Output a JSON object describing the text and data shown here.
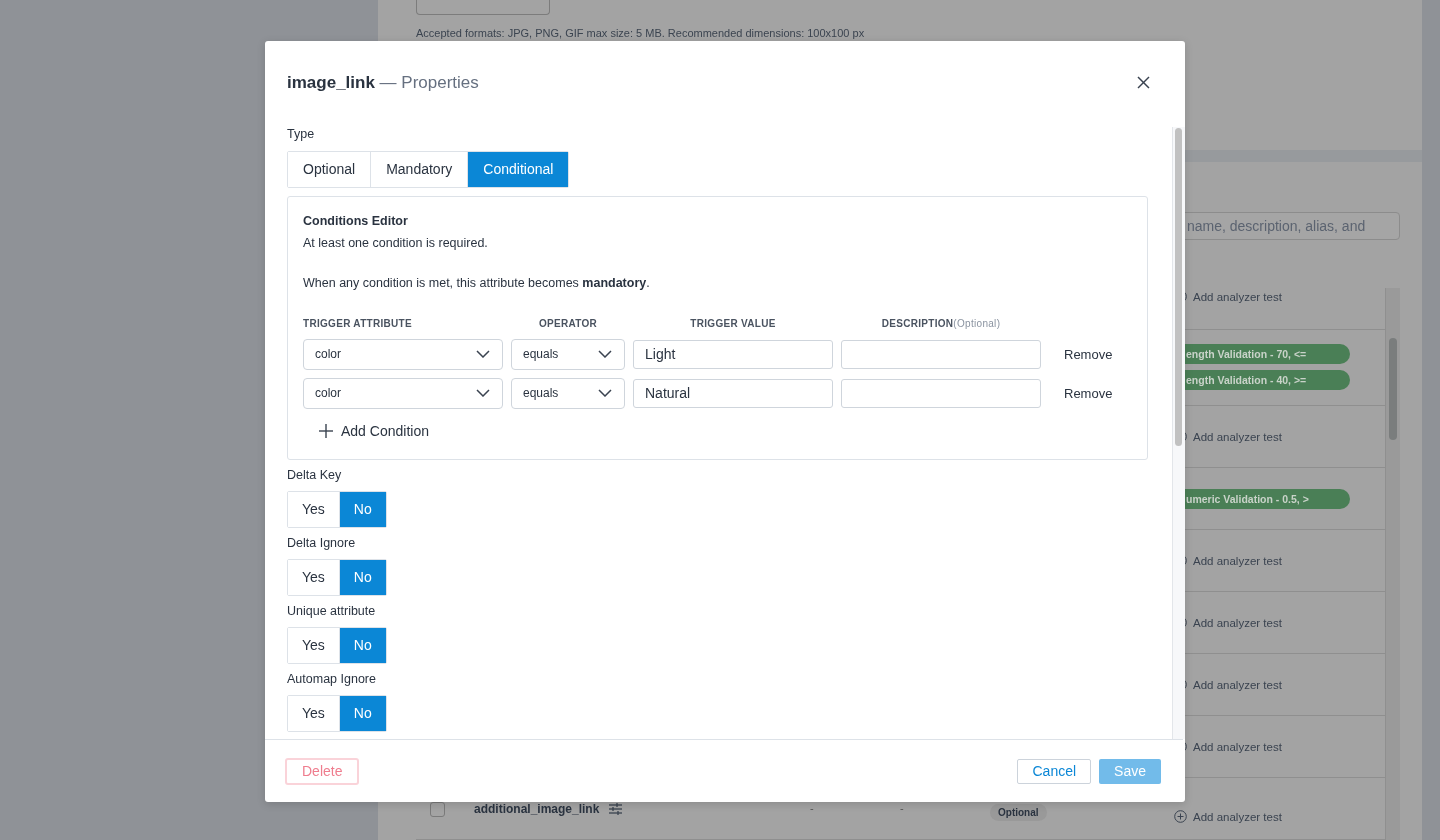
{
  "page": {
    "upload_hint": "Accepted formats: JPG, PNG, GIF max size: 5 MB. Recommended dimensions: 100x100 px",
    "search": {
      "placeholder": "name, description, alias, and"
    },
    "rows": [
      {
        "tests": [
          {
            "kind": "add",
            "label": "Add analyzer test"
          }
        ]
      },
      {
        "tests": [
          {
            "kind": "tag",
            "label": "ength Validation - 70, <="
          },
          {
            "kind": "tag",
            "label": "ength Validation - 40, >="
          }
        ]
      },
      {
        "tests": [
          {
            "kind": "add",
            "label": "Add analyzer test"
          }
        ]
      },
      {
        "tests": [
          {
            "kind": "tag",
            "label": "umeric Validation - 0.5, >"
          }
        ]
      },
      {
        "tests": [
          {
            "kind": "add",
            "label": "Add analyzer test"
          }
        ]
      },
      {
        "tests": [
          {
            "kind": "add",
            "label": "Add analyzer test"
          }
        ]
      },
      {
        "tests": [
          {
            "kind": "add",
            "label": "Add analyzer test"
          }
        ]
      },
      {
        "tests": [
          {
            "kind": "add",
            "label": "Add analyzer test"
          }
        ]
      },
      {
        "checked": false,
        "name": "additional_image_link",
        "column_4": "-",
        "column_5": "-",
        "type_badge": "Optional",
        "tests": [
          {
            "kind": "add",
            "label": "Add analyzer test"
          }
        ]
      }
    ]
  },
  "modal": {
    "title": "image_link",
    "subtitle": "— Properties",
    "type": {
      "label": "Type",
      "options": [
        {
          "label": "Optional",
          "selected": false
        },
        {
          "label": "Mandatory",
          "selected": false
        },
        {
          "label": "Conditional",
          "selected": true
        }
      ]
    },
    "conditions": {
      "title": "Conditions Editor",
      "note": "At least one condition is required.",
      "rule": "When any condition is met, this attribute becomes **mandatory**.",
      "headers": [
        {
          "label": "TRIGGER ATTRIBUTE"
        },
        {
          "label": "OPERATOR"
        },
        {
          "label": "TRIGGER VALUE"
        },
        {
          "label": "DESCRIPTION",
          "note": "(Optional)"
        }
      ],
      "rows": [
        {
          "attribute": "color",
          "operator": "equals",
          "value": "Light",
          "remove": "Remove"
        },
        {
          "attribute": "color",
          "operator": "equals",
          "value": "Natural",
          "remove": "Remove"
        }
      ],
      "add": "Add Condition"
    },
    "flags": [
      {
        "label": "Delta Key",
        "options": [
          {
            "label": "Yes",
            "selected": false
          },
          {
            "label": "No",
            "selected": true
          }
        ]
      },
      {
        "label": "Delta Ignore",
        "options": [
          {
            "label": "Yes",
            "selected": false
          },
          {
            "label": "No",
            "selected": true
          }
        ]
      },
      {
        "label": "Unique attribute",
        "options": [
          {
            "label": "Yes",
            "selected": false
          },
          {
            "label": "No",
            "selected": true
          }
        ]
      },
      {
        "label": "Automap Ignore",
        "options": [
          {
            "label": "Yes",
            "selected": false
          },
          {
            "label": "No",
            "selected": true
          }
        ]
      }
    ],
    "footer": {
      "delete": {
        "label": "Delete",
        "disabled": true
      },
      "cancel": {
        "label": "Cancel",
        "disabled": false
      },
      "save": {
        "label": "Save",
        "disabled": true
      }
    }
  }
}
